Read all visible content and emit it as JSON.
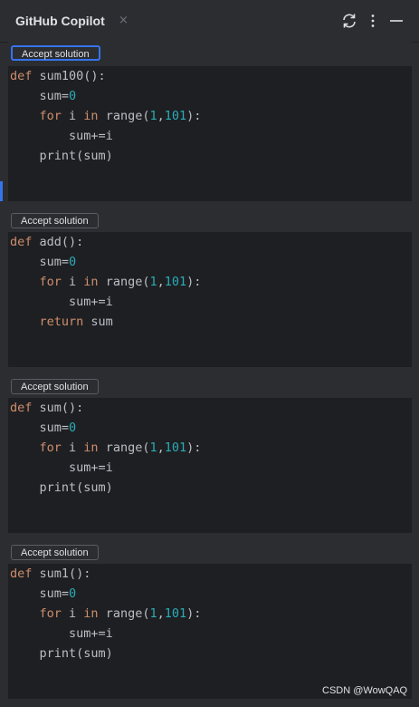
{
  "header": {
    "title": "GitHub Copilot",
    "close_glyph": "×",
    "icons": [
      "refresh-icon",
      "more-vertical-icon",
      "minimize-icon"
    ]
  },
  "solutions": [
    {
      "button_label": "Accept solution",
      "lines": [
        [
          {
            "t": "def",
            "c": "kw"
          },
          {
            "t": " sum100():",
            "c": "plain"
          }
        ],
        [
          {
            "t": "    sum=",
            "c": "plain"
          },
          {
            "t": "0",
            "c": "num"
          }
        ],
        [
          {
            "t": "    ",
            "c": "plain"
          },
          {
            "t": "for",
            "c": "kw"
          },
          {
            "t": " i ",
            "c": "plain"
          },
          {
            "t": "in",
            "c": "kw"
          },
          {
            "t": " range(",
            "c": "plain"
          },
          {
            "t": "1",
            "c": "num"
          },
          {
            "t": ",",
            "c": "plain"
          },
          {
            "t": "101",
            "c": "num"
          },
          {
            "t": "):",
            "c": "plain"
          }
        ],
        [
          {
            "t": "        sum+=i",
            "c": "plain"
          }
        ],
        [
          {
            "t": "    print(sum)",
            "c": "plain"
          }
        ]
      ]
    },
    {
      "button_label": "Accept solution",
      "lines": [
        [
          {
            "t": "def",
            "c": "kw"
          },
          {
            "t": " add():",
            "c": "plain"
          }
        ],
        [
          {
            "t": "    sum=",
            "c": "plain"
          },
          {
            "t": "0",
            "c": "num"
          }
        ],
        [
          {
            "t": "    ",
            "c": "plain"
          },
          {
            "t": "for",
            "c": "kw"
          },
          {
            "t": " i ",
            "c": "plain"
          },
          {
            "t": "in",
            "c": "kw"
          },
          {
            "t": " range(",
            "c": "plain"
          },
          {
            "t": "1",
            "c": "num"
          },
          {
            "t": ",",
            "c": "plain"
          },
          {
            "t": "101",
            "c": "num"
          },
          {
            "t": "):",
            "c": "plain"
          }
        ],
        [
          {
            "t": "        sum+=i",
            "c": "plain"
          }
        ],
        [
          {
            "t": "    ",
            "c": "plain"
          },
          {
            "t": "return",
            "c": "kw"
          },
          {
            "t": " sum",
            "c": "plain"
          }
        ]
      ]
    },
    {
      "button_label": "Accept solution",
      "lines": [
        [
          {
            "t": "def",
            "c": "kw"
          },
          {
            "t": " sum():",
            "c": "plain"
          }
        ],
        [
          {
            "t": "    sum=",
            "c": "plain"
          },
          {
            "t": "0",
            "c": "num"
          }
        ],
        [
          {
            "t": "    ",
            "c": "plain"
          },
          {
            "t": "for",
            "c": "kw"
          },
          {
            "t": " i ",
            "c": "plain"
          },
          {
            "t": "in",
            "c": "kw"
          },
          {
            "t": " range(",
            "c": "plain"
          },
          {
            "t": "1",
            "c": "num"
          },
          {
            "t": ",",
            "c": "plain"
          },
          {
            "t": "101",
            "c": "num"
          },
          {
            "t": "):",
            "c": "plain"
          }
        ],
        [
          {
            "t": "        sum+=i",
            "c": "plain"
          }
        ],
        [
          {
            "t": "    print(sum)",
            "c": "plain"
          }
        ]
      ]
    },
    {
      "button_label": "Accept solution",
      "lines": [
        [
          {
            "t": "def",
            "c": "kw"
          },
          {
            "t": " sum1():",
            "c": "plain"
          }
        ],
        [
          {
            "t": "    sum=",
            "c": "plain"
          },
          {
            "t": "0",
            "c": "num"
          }
        ],
        [
          {
            "t": "    ",
            "c": "plain"
          },
          {
            "t": "for",
            "c": "kw"
          },
          {
            "t": " i ",
            "c": "plain"
          },
          {
            "t": "in",
            "c": "kw"
          },
          {
            "t": " range(",
            "c": "plain"
          },
          {
            "t": "1",
            "c": "num"
          },
          {
            "t": ",",
            "c": "plain"
          },
          {
            "t": "101",
            "c": "num"
          },
          {
            "t": "):",
            "c": "plain"
          }
        ],
        [
          {
            "t": "        sum+=i",
            "c": "plain"
          }
        ],
        [
          {
            "t": "    print(sum)",
            "c": "plain"
          }
        ]
      ]
    }
  ],
  "watermark": "CSDN @WowQAQ",
  "colors": {
    "keyword": "#cf8e6d",
    "number": "#2aacb8",
    "text": "#bcbec4",
    "focus": "#3574f0"
  }
}
